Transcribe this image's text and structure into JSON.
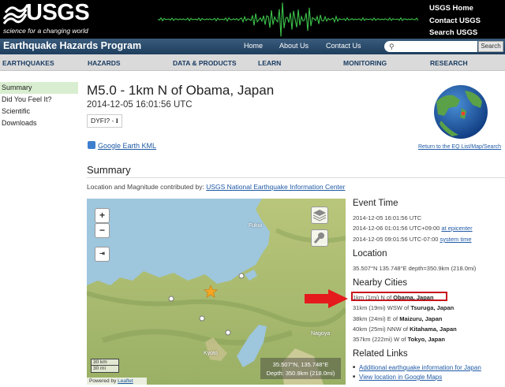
{
  "header": {
    "logo_text": "USGS",
    "logo_tagline": "science for a changing world",
    "top_links": [
      "USGS Home",
      "Contact USGS",
      "Search USGS"
    ]
  },
  "navbar": {
    "program_title": "Earthquake Hazards Program",
    "links": [
      "Home",
      "About Us",
      "Contact Us"
    ],
    "search_button": "Search"
  },
  "menu": {
    "items": [
      "EARTHQUAKES",
      "HAZARDS",
      "DATA & PRODUCTS",
      "LEARN",
      "MONITORING",
      "RESEARCH"
    ]
  },
  "sidebar": {
    "items": [
      "Summary",
      "Did You Feel It?",
      "Scientific",
      "Downloads"
    ]
  },
  "event": {
    "title": "M5.0 - 1km N of Obama, Japan",
    "time": "2014-12-05 16:01:56 UTC",
    "dyfi_label": "DYFI? -",
    "dyfi_value": "I",
    "google_earth": "Google Earth KML",
    "return_link": "Return to the EQ List/Map/Search"
  },
  "summary": {
    "heading": "Summary",
    "contrib_prefix": "Location and Magnitude contributed by:",
    "contrib_link": "USGS National Earthquake Information Center"
  },
  "map": {
    "city_fukui": "Fukui",
    "city_kyoto": "Kyoto",
    "city_nagoya": "Nagoya",
    "scale_km": "30 km",
    "scale_mi": "30 mi",
    "coord_line1": "35.507°N, 135.748°E",
    "coord_line2": "Depth: 350.9km (218.0mi)",
    "attrib_prefix": "Powered by",
    "attrib_link": "Leaflet",
    "zoom_in": "+",
    "zoom_out": "−"
  },
  "event_time": {
    "heading": "Event Time",
    "utc": "2014-12-05 16:01:56 UTC",
    "epicenter_time": "2014-12-06 01:01:56 UTC+09:00",
    "epicenter_label": "at epicenter",
    "system_time_value": "2014-12-05 09:01:56 UTC-07:00",
    "system_time_label": "system time"
  },
  "location": {
    "heading": "Location",
    "text": "35.507°N 135.748°E depth=350.9km (218.0mi)"
  },
  "nearby": {
    "heading": "Nearby Cities",
    "cities": [
      {
        "prefix": "1km (1mi) N of",
        "name": "Obama, Japan"
      },
      {
        "prefix": "31km (19mi) WSW of",
        "name": "Tsuruga, Japan"
      },
      {
        "prefix": "38km (24mi) E of",
        "name": "Maizuru, Japan"
      },
      {
        "prefix": "40km (25mi) NNW of",
        "name": "Kitahama, Japan"
      },
      {
        "prefix": "357km (222mi) W of",
        "name": "Tokyo, Japan"
      }
    ]
  },
  "related": {
    "heading": "Related Links",
    "links": [
      "Additional earthquake information for Japan",
      "View location in Google Maps"
    ]
  },
  "colors": {
    "header_bg": "#000000",
    "navbar_bg": "#2a4b6d",
    "menu_bg": "#dadada",
    "highlight": "#c6151c",
    "sidebar_selected": "#d9eed0",
    "epicenter_star": "#f5a623"
  }
}
